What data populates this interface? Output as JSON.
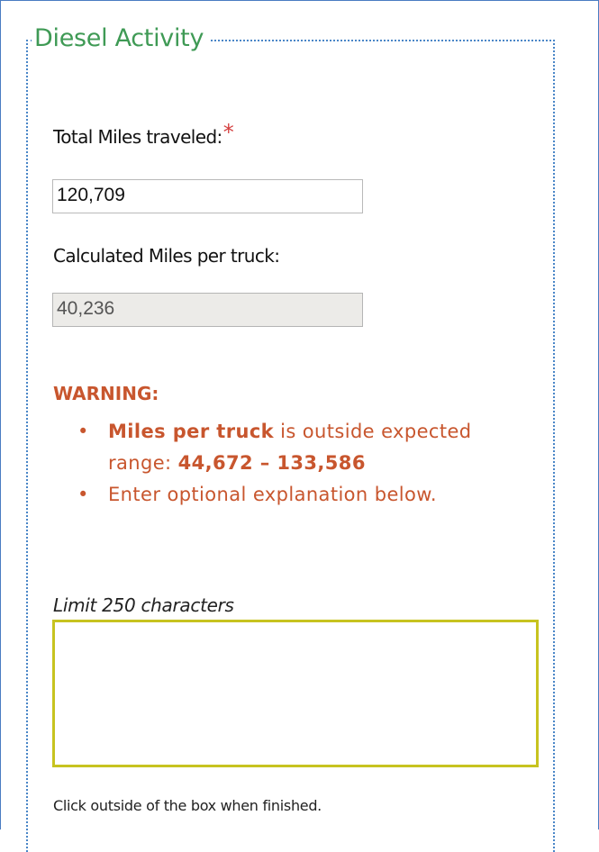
{
  "section": {
    "title": "Diesel Activity"
  },
  "total_miles": {
    "label": "Total Miles traveled:",
    "required_mark": "*",
    "value": "120,709"
  },
  "calculated_miles": {
    "label": "Calculated Miles per truck:",
    "value": "40,236"
  },
  "warning": {
    "heading": "WARNING:",
    "item1_bold": "Miles per truck",
    "item1_text": " is outside expected range: ",
    "item1_range": "44,672 – 133,586",
    "item2": "Enter optional explanation below."
  },
  "explanation": {
    "limit_label": "Limit 250 characters",
    "value": "",
    "hint": "Click outside of the box when finished."
  },
  "colors": {
    "legend": "#3f9a55",
    "warning": "#c8562e",
    "required": "#d43f3f",
    "textarea_border": "#c7c320",
    "fieldset_border": "#4a86c7"
  }
}
